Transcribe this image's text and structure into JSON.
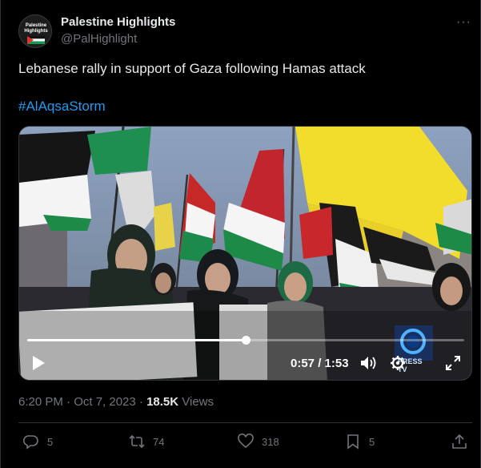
{
  "author": {
    "display_name": "Palestine Highlights",
    "handle": "@PalHighlight",
    "avatar_text": "Palestine Highlights"
  },
  "tweet": {
    "text": "Lebanese rally in support of Gaza following Hamas attack",
    "hashtag": "#AlAqsaStorm"
  },
  "video": {
    "time": "0:57 / 1:53",
    "progress": 0.5,
    "channel_logo_text": "PRESS TV",
    "icons": [
      "play-icon",
      "volume-icon",
      "settings-icon",
      "fullscreen-icon"
    ]
  },
  "meta": {
    "timestamp": "6:20 PM · Oct 7, 2023 · ",
    "views_count": "18.5K",
    "views_label": " Views"
  },
  "actions": {
    "replies": "5",
    "retweets": "74",
    "likes": "318",
    "bookmarks": "5"
  },
  "colors": {
    "background": "#000000",
    "text": "#e7e9ea",
    "muted": "#71767b",
    "link": "#1d9bf0",
    "divider": "#2f3336"
  }
}
